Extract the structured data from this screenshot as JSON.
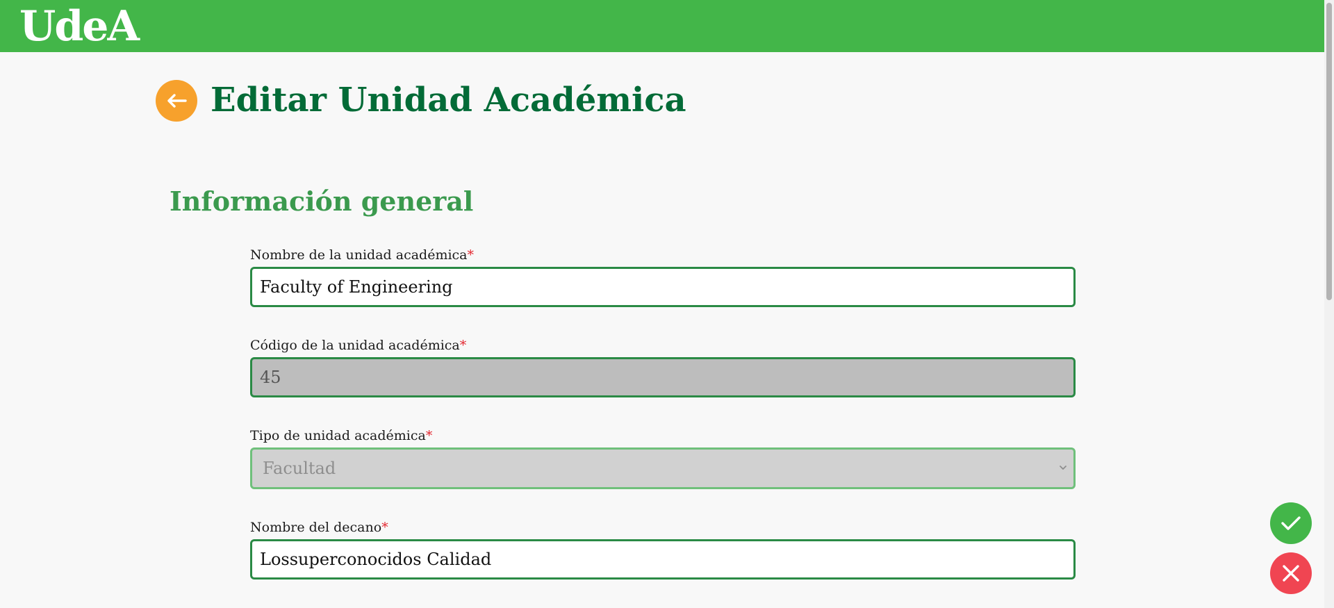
{
  "header": {
    "logo_text": "UdeA",
    "brand_color": "#43b649"
  },
  "page": {
    "title": "Editar Unidad Académica",
    "back_icon": "arrow-left-icon"
  },
  "section": {
    "title": "Información general"
  },
  "form": {
    "required_marker": "*",
    "fields": [
      {
        "label": "Nombre de la unidad académica",
        "value": "Faculty of Engineering",
        "disabled": false
      },
      {
        "label": "Código de la unidad académica",
        "value": "45",
        "disabled": true
      },
      {
        "label": "Tipo de unidad académica",
        "value": "Facultad",
        "disabled": true,
        "type": "select"
      },
      {
        "label": "Nombre del decano",
        "value": "Lossuperconocidos Calidad",
        "disabled": false
      }
    ]
  },
  "actions": {
    "save_icon": "check-icon",
    "cancel_icon": "close-icon",
    "save_color": "#43b649",
    "cancel_color": "#f04552"
  }
}
